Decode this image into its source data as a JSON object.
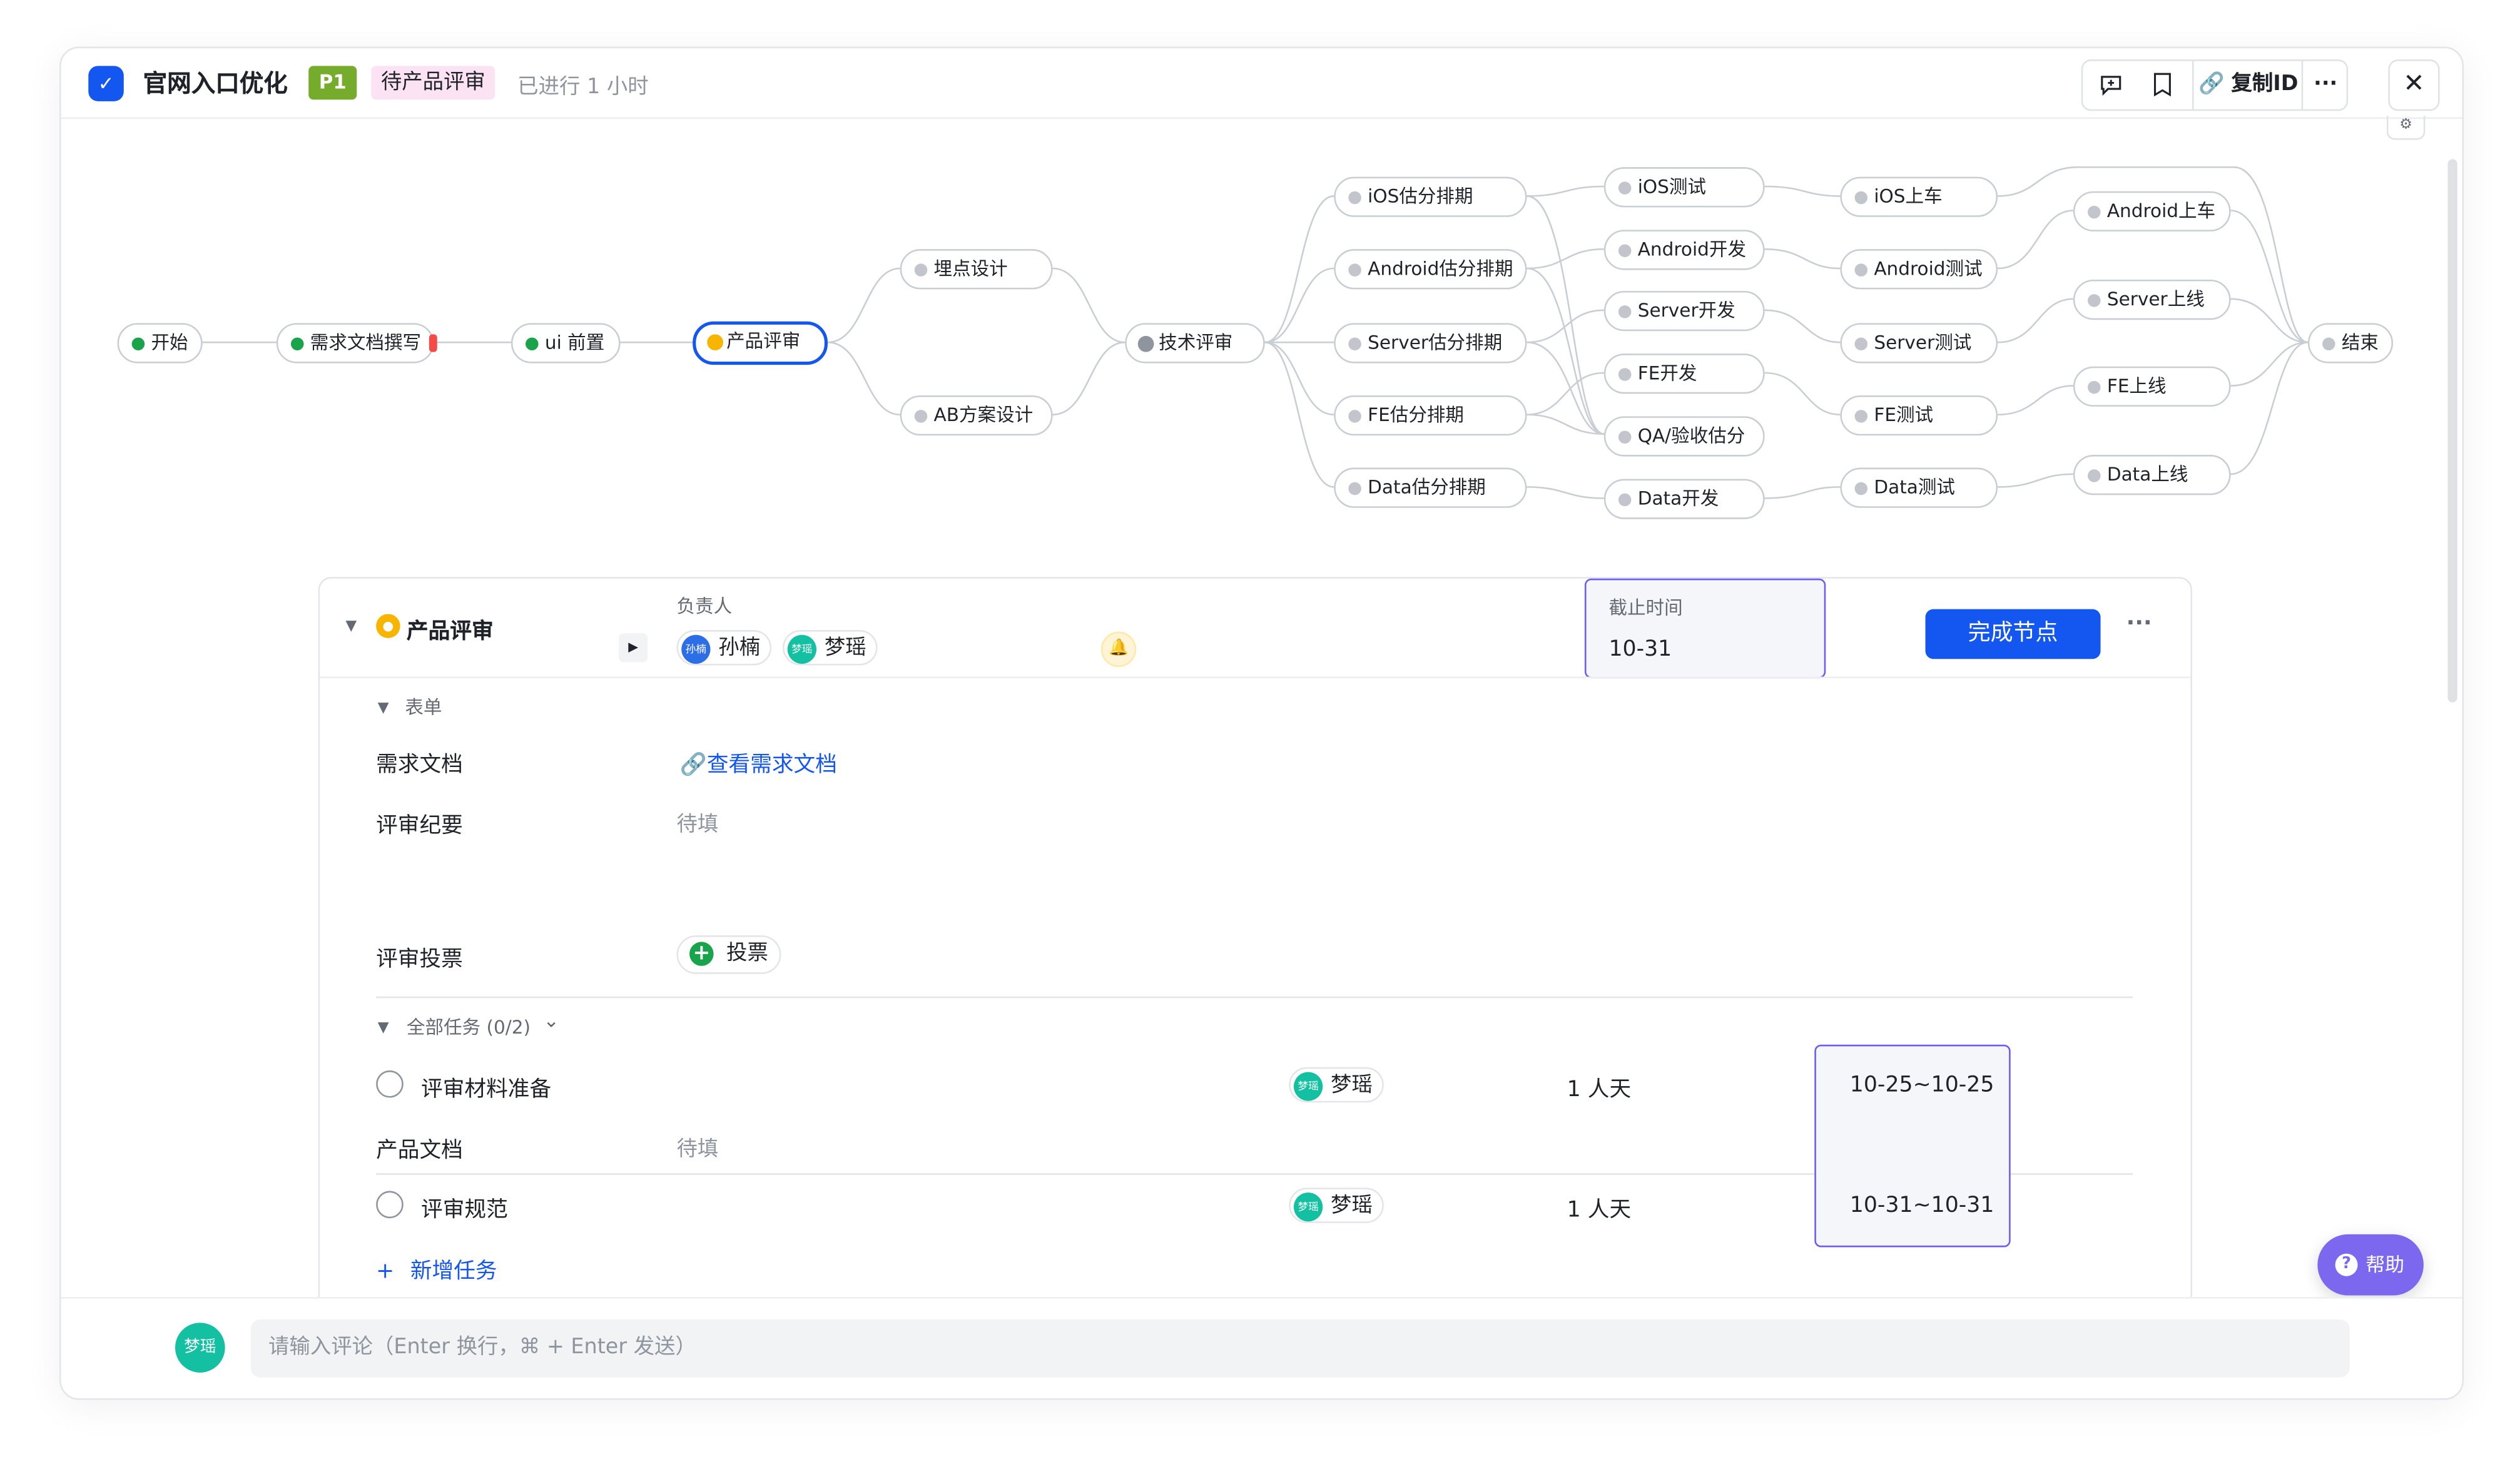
{
  "header": {
    "app_icon": "✓",
    "title": "官网入口优化",
    "priority": "P1",
    "status": "待产品评审",
    "elapsed": "已进行 1 小时",
    "toolbar": {
      "comment_icon": "chat-add-icon",
      "bookmark_icon": "bookmark-icon",
      "copy_id_label": "复制ID",
      "more": "···"
    },
    "close": "✕",
    "settings_icon": "⚙"
  },
  "flow": {
    "nodes": {
      "start": "开始",
      "prd": "需求文档撰写",
      "ui": "ui 前置",
      "review": "产品评审",
      "tracking": "埋点设计",
      "ab": "AB方案设计",
      "tech": "技术评审",
      "ios_est": "iOS估分排期",
      "android_est": "Android估分排期",
      "server_est": "Server估分排期",
      "fe_est": "FE估分排期",
      "data_est": "Data估分排期",
      "ios_test": "iOS测试",
      "android_dev": "Android开发",
      "server_dev": "Server开发",
      "fe_dev": "FE开发",
      "qa_est": "QA/验收估分",
      "data_dev": "Data开发",
      "ios_release": "iOS上车",
      "android_test": "Android测试",
      "server_test": "Server测试",
      "fe_test": "FE测试",
      "data_test": "Data测试",
      "android_release": "Android上车",
      "server_release": "Server上线",
      "fe_release": "FE上线",
      "data_release": "Data上线",
      "end": "结束"
    }
  },
  "panel": {
    "node_title": "产品评审",
    "owner_label": "负责人",
    "owners": [
      {
        "avatar": "孙楠",
        "name": "孙楠"
      },
      {
        "avatar": "梦瑶",
        "name": "梦瑶"
      }
    ],
    "deadline_label": "截止时间",
    "deadline_value": "10-31",
    "complete_button": "完成节点",
    "more": "···",
    "form_section": "表单",
    "fields": {
      "prd_label": "需求文档",
      "prd_link": "查看需求文档",
      "minutes_label": "评审纪要",
      "minutes_value": "待填",
      "vote_label": "评审投票",
      "vote_button": "投票"
    },
    "tasks_section": "全部任务 (0/2)",
    "tasks": [
      {
        "name": "评审材料准备",
        "assignee": "梦瑶",
        "effort": "1 人天",
        "dates": "10-25~10-25"
      },
      {
        "name": "评审规范",
        "assignee": "梦瑶",
        "effort": "1 人天",
        "dates": "10-31~10-31"
      }
    ],
    "product_doc_label": "产品文档",
    "product_doc_value": "待填",
    "add_task": "新增任务"
  },
  "help": {
    "label": "帮助",
    "icon": "?"
  },
  "comment": {
    "avatar": "梦瑶",
    "placeholder": "请输入评论（Enter 换行，⌘ + Enter 发送）"
  },
  "colors": {
    "primary": "#1456f0",
    "done": "#19a34a",
    "current": "#f7b500",
    "highlight_border": "#6b5cf6",
    "help": "#7b68ee",
    "priority": "#76ac2b",
    "status_bg": "#fbe3f4"
  }
}
